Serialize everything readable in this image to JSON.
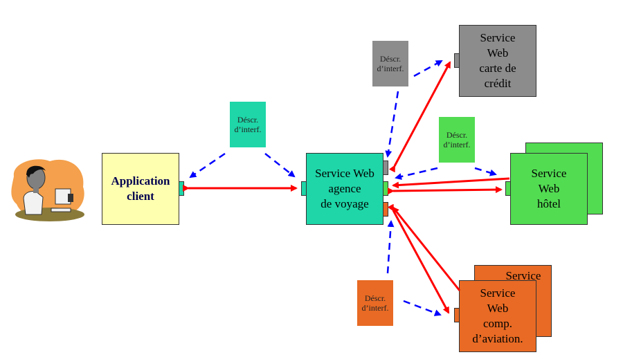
{
  "colors": {
    "client": "#ffffb0",
    "agency": "#1ed6a8",
    "credit": "#8c8c8c",
    "hotel": "#52dc52",
    "airline": "#e86a24",
    "message_arrow": "#ff0000",
    "description_arrow": "#0000ff",
    "client_text": "#000050"
  },
  "client_icon": "person-at-computer-icon",
  "client_app": {
    "label": "Application\nclient"
  },
  "agency": {
    "label": "Service Web\nagence\nde voyage"
  },
  "credit": {
    "label": "Service\nWeb\ncarte de\ncrédit"
  },
  "hotel": {
    "label": "Service\nWeb\nhôtel"
  },
  "airline": {
    "label": "Service\nWeb\ncomp.\nd’aviation.",
    "back_label": "Service"
  },
  "descriptions": {
    "agency": "Déscr.\nd’interf.",
    "credit": "Déscr.\nd’interf.",
    "hotel": "Déscr.\nd’interf.",
    "airline": "Déscr.\nd’interf."
  }
}
